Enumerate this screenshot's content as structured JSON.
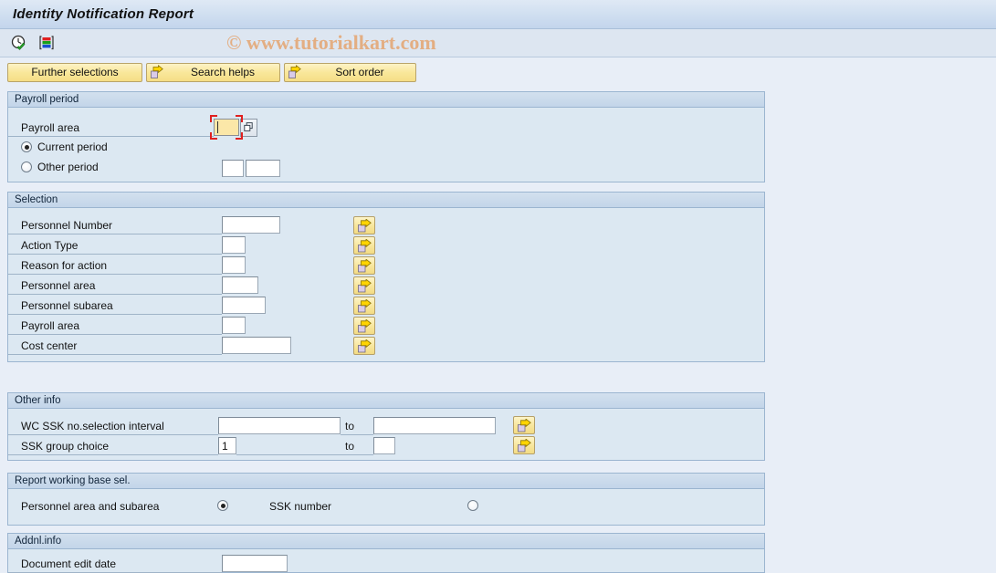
{
  "window": {
    "title": "Identity Notification Report",
    "watermark": "© www.tutorialkart.com"
  },
  "icon_toolbar": {
    "items": [
      {
        "name": "execute-clock-icon",
        "tooltip": "Execute"
      },
      {
        "name": "color-bars-icon",
        "tooltip": "Get Variant"
      }
    ]
  },
  "toolbar": {
    "further_selections_label": "Further selections",
    "search_helps_label": "Search helps",
    "sort_order_label": "Sort order"
  },
  "payroll_period": {
    "title": "Payroll period",
    "payroll_area_label": "Payroll area",
    "payroll_area_value": "",
    "current_period_label": "Current period",
    "other_period_label": "Other period",
    "selected": "current",
    "other_period_value_1": "",
    "other_period_value_2": ""
  },
  "selection": {
    "title": "Selection",
    "rows": [
      {
        "label": "Personnel Number",
        "value": ""
      },
      {
        "label": "Action Type",
        "value": ""
      },
      {
        "label": "Reason for action",
        "value": ""
      },
      {
        "label": "Personnel area",
        "value": ""
      },
      {
        "label": "Personnel subarea",
        "value": ""
      },
      {
        "label": "Payroll area",
        "value": ""
      },
      {
        "label": "Cost center",
        "value": ""
      }
    ]
  },
  "other_info": {
    "title": "Other info",
    "to_label_1": "to",
    "to_label_2": "to",
    "rows": [
      {
        "label": "WC SSK no.selection interval",
        "from": "",
        "to": ""
      },
      {
        "label": "SSK group choice",
        "from": "1",
        "to": ""
      }
    ]
  },
  "report_base": {
    "title": "Report working base sel.",
    "option_1_label": "Personnel area and subarea",
    "option_2_label": "SSK number",
    "selected": "option_1"
  },
  "addnl_info": {
    "title": "Addnl.info",
    "document_edit_date_label": "Document edit date",
    "document_edit_date_value": ""
  },
  "colors": {
    "page_background": "#e8eef7",
    "panel_background": "#dce8f2",
    "panel_header": "#c6d8ea",
    "button_yellow": "#f9e79a",
    "watermark": "#e3ae83",
    "focus_red": "#e02020",
    "focus_field": "#fbe7a8"
  }
}
